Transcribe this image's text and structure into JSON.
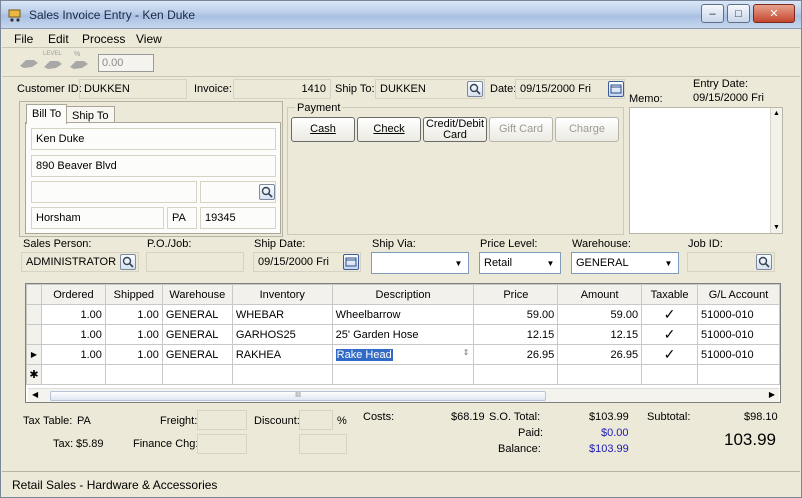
{
  "window": {
    "title": "Sales Invoice Entry - Ken Duke",
    "minimize": "–",
    "maximize": "□",
    "close": "✕"
  },
  "menu": [
    "File",
    "Edit",
    "Process",
    "View"
  ],
  "toolbar": {
    "icon_labels": [
      "",
      "LEVEL",
      "%"
    ],
    "discount_value": "0.00"
  },
  "header": {
    "customer_id_label": "Customer ID:",
    "customer_id": "DUKKEN",
    "invoice_label": "Invoice:",
    "invoice": "1410",
    "ship_to_label": "Ship To:",
    "ship_to": "DUKKEN",
    "date_label": "Date:",
    "date": "09/15/2000 Fri",
    "entry_date_label": "Entry Date:",
    "entry_date": "09/15/2000 Fri",
    "memo_label": "Memo:"
  },
  "address_tabs": {
    "bill_to": "Bill To",
    "ship_to": "Ship To",
    "name": "Ken Duke",
    "street": "890 Beaver Blvd",
    "city": "Horsham",
    "state": "PA",
    "zip": "19345"
  },
  "payment": {
    "label": "Payment",
    "cash": "Cash",
    "check": "Check",
    "credit_debit": "Credit/Debit Card",
    "gift_card": "Gift Card",
    "charge": "Charge"
  },
  "details": {
    "sales_person_label": "Sales Person:",
    "sales_person": "ADMINISTRATOR",
    "po_job_label": "P.O./Job:",
    "ship_date_label": "Ship Date:",
    "ship_date": "09/15/2000 Fri",
    "ship_via_label": "Ship Via:",
    "price_level_label": "Price Level:",
    "price_level": "Retail",
    "warehouse_label": "Warehouse:",
    "warehouse": "GENERAL",
    "job_id_label": "Job ID:"
  },
  "grid": {
    "columns": [
      "Ordered",
      "Shipped",
      "Warehouse",
      "Inventory",
      "Description",
      "Price",
      "Amount",
      "Taxable",
      "G/L Account"
    ],
    "rows": [
      {
        "ordered": "1.00",
        "shipped": "1.00",
        "warehouse": "GENERAL",
        "inventory": "WHEBAR",
        "description": "Wheelbarrow",
        "price": "59.00",
        "amount": "59.00",
        "taxable": "✓",
        "gl": "51000-010"
      },
      {
        "ordered": "1.00",
        "shipped": "1.00",
        "warehouse": "GENERAL",
        "inventory": "GARHOS25",
        "description": "25' Garden Hose",
        "price": "12.15",
        "amount": "12.15",
        "taxable": "✓",
        "gl": "51000-010"
      },
      {
        "ordered": "1.00",
        "shipped": "1.00",
        "warehouse": "GENERAL",
        "inventory": "RAKHEA",
        "description": "Rake Head",
        "price": "26.95",
        "amount": "26.95",
        "taxable": "✓",
        "gl": "51000-010"
      }
    ],
    "current_row_marker": "▶",
    "new_row_marker": "✱",
    "scroll_grip": "III"
  },
  "totals": {
    "tax_table_label": "Tax Table:",
    "tax_table": "PA",
    "tax_label": "Tax:",
    "tax": "$5.89",
    "freight_label": "Freight:",
    "finance_chg_label": "Finance Chg:",
    "discount_label": "Discount:",
    "percent": "%",
    "costs_label": "Costs:",
    "costs": "$68.19",
    "so_total_label": "S.O. Total:",
    "so_total": "$103.99",
    "paid_label": "Paid:",
    "paid": "$0.00",
    "balance_label": "Balance:",
    "balance": "$103.99",
    "subtotal_label": "Subtotal:",
    "subtotal": "$98.10",
    "grand_total": "103.99"
  },
  "status": "Retail Sales - Hardware & Accessories"
}
